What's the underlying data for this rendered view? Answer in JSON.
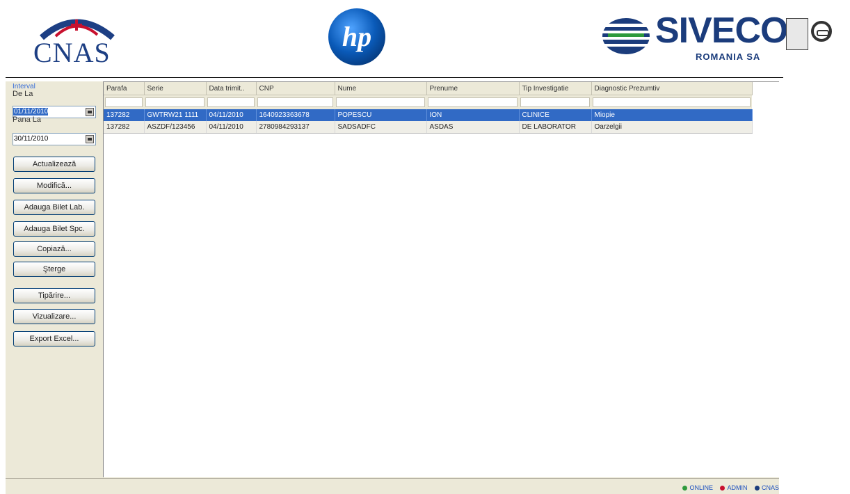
{
  "header": {
    "cnas_logo_text": "CNAS",
    "hp_logo_text": "hp",
    "siveco_logo_text": "SIVECO",
    "siveco_subtitle": "ROMANIA SA"
  },
  "sidebar": {
    "interval_label": "Interval",
    "from_label": "De La",
    "from_value": "01/11/2010",
    "to_label": "Pana La",
    "to_value": "30/11/2010",
    "buttons": [
      "Actualizează",
      "Modifică...",
      "Adauga Bilet Lab.",
      "Adauga Bilet Spc.",
      "Copiază...",
      "Şterge",
      "Tipărire...",
      "Vizualizare...",
      "Export Excel..."
    ]
  },
  "grid": {
    "columns": [
      "Parafa",
      "Serie",
      "Data trimit..",
      "CNP",
      "Nume",
      "Prenume",
      "Tip Investigatie",
      "Diagnostic Prezumtiv"
    ],
    "rows": [
      [
        "137282",
        "GWTRW21 1111",
        "04/11/2010",
        "1640923363678",
        "POPESCU",
        "ION",
        "CLINICE",
        "Miopie"
      ],
      [
        "137282",
        "ASZDF/123456",
        "04/11/2010",
        "2780984293137",
        "SADSADFC",
        "ASDAS",
        "DE LABORATOR",
        "Oarzelgii"
      ]
    ],
    "selected_row": 0
  },
  "statusbar": {
    "online": "ONLINE",
    "user": "ADMIN",
    "org": "CNAS"
  },
  "colors": {
    "selection": "#316ac5",
    "brand_blue": "#1b3c7c",
    "cnas_red": "#c8102e",
    "hp_blue": "#0a5ab8"
  }
}
